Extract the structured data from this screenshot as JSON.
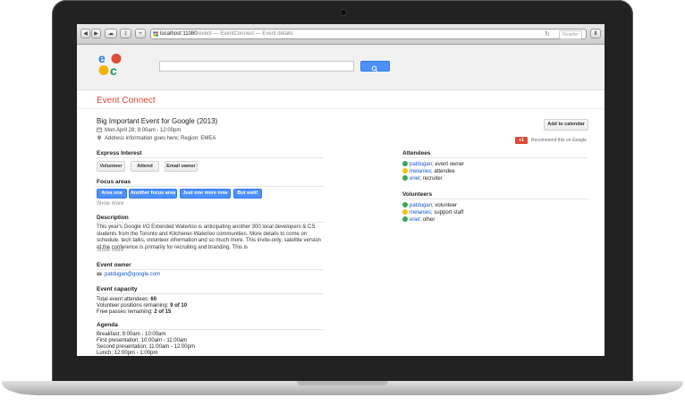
{
  "browser": {
    "url_host": "localhost:11080",
    "url_rest": "/event — EventConnect — Event details",
    "reader_label": "Reader",
    "back_label": "◀",
    "forward_label": "▶",
    "add_label": "+"
  },
  "header": {
    "app_name": "Event Connect",
    "search": {
      "placeholder": ""
    },
    "logo_colors": [
      "#2a7ae2",
      "#dd4b39",
      "#f4b400",
      "#0f9d58"
    ]
  },
  "event": {
    "title": "Big Important Event for Google (2013)",
    "date": "Mon April 28; 8:00am - 12:00pm",
    "address": "Address information goes here; Region: EMEA",
    "add_to_calendar_label": "Add to calendar",
    "gplus_label": "+1",
    "recommend_text": "Recommend this on Google"
  },
  "express_interest": {
    "heading": "Express Interest",
    "buttons": [
      "Volunteer",
      "Attend",
      "Email owner"
    ]
  },
  "focus_areas": {
    "heading": "Focus areas",
    "tags": [
      "Area one",
      "Another focus area",
      "Just one more now",
      "But wait!"
    ],
    "show_more": "Show more"
  },
  "description": {
    "heading": "Description",
    "text": "This year's Google I/O Extended Waterloo is anticipating another 300 local developers & CS students from the Toronto and Kitchener-Waterloo communities. More details to come on schedule, tech talks, volunteer information and so much more. This invite-only, satellite version of the conference is primarily for recruiting and branding. This is",
    "show_more": "Show more"
  },
  "event_owner": {
    "heading": "Event owner",
    "email": "patdugan@google.com"
  },
  "capacity": {
    "heading": "Event capacity",
    "total_label": "Total event attendees:",
    "total_value": "60",
    "volunteer_label": "Volunteer positions remaining:",
    "volunteer_value": "9 of 10",
    "passes_label": "Free passes remaining:",
    "passes_value": "2 of 15"
  },
  "agenda": {
    "heading": "Agenda",
    "items": [
      "Breakfast; 9:00am - 10:00am",
      "First presentation; 10:00am - 11:00am",
      "Second presentation; 11:00am - 12:00pm",
      "Lunch; 12:00pm - 1:00pm"
    ]
  },
  "attendees": {
    "heading": "Attendees",
    "items": [
      {
        "name": "patdugan",
        "role": "; event owner",
        "status": "green"
      },
      {
        "name": "melanies",
        "role": "; attendee",
        "status": "yellow"
      },
      {
        "name": "eriel",
        "role": "; recruiter",
        "status": "green"
      }
    ]
  },
  "volunteers": {
    "heading": "Volunteers",
    "items": [
      {
        "name": "patdugan",
        "role": "; volunteer",
        "status": "green"
      },
      {
        "name": "melanies",
        "role": "; support staff",
        "status": "yellow"
      },
      {
        "name": "eriel",
        "role": "; other",
        "status": "green"
      }
    ]
  }
}
